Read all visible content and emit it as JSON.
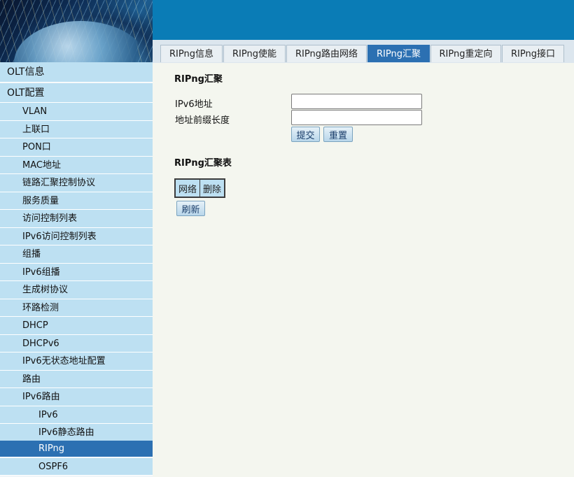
{
  "sidebar": {
    "items": [
      {
        "label": "OLT信息",
        "level": 0,
        "active": false
      },
      {
        "label": "OLT配置",
        "level": 0,
        "active": false
      },
      {
        "label": "VLAN",
        "level": 1,
        "active": false
      },
      {
        "label": "上联口",
        "level": 1,
        "active": false
      },
      {
        "label": "PON口",
        "level": 1,
        "active": false
      },
      {
        "label": "MAC地址",
        "level": 1,
        "active": false
      },
      {
        "label": "链路汇聚控制协议",
        "level": 1,
        "active": false
      },
      {
        "label": "服务质量",
        "level": 1,
        "active": false
      },
      {
        "label": "访问控制列表",
        "level": 1,
        "active": false
      },
      {
        "label": "IPv6访问控制列表",
        "level": 1,
        "active": false
      },
      {
        "label": "组播",
        "level": 1,
        "active": false
      },
      {
        "label": "IPv6组播",
        "level": 1,
        "active": false
      },
      {
        "label": "生成树协议",
        "level": 1,
        "active": false
      },
      {
        "label": "环路检测",
        "level": 1,
        "active": false
      },
      {
        "label": "DHCP",
        "level": 1,
        "active": false
      },
      {
        "label": "DHCPv6",
        "level": 1,
        "active": false
      },
      {
        "label": "IPv6无状态地址配置",
        "level": 1,
        "active": false
      },
      {
        "label": "路由",
        "level": 1,
        "active": false
      },
      {
        "label": "IPv6路由",
        "level": 1,
        "active": false
      },
      {
        "label": "IPv6",
        "level": 2,
        "active": false
      },
      {
        "label": "IPv6静态路由",
        "level": 2,
        "active": false
      },
      {
        "label": "RIPng",
        "level": 2,
        "active": true
      },
      {
        "label": "OSPF6",
        "level": 2,
        "active": false
      }
    ]
  },
  "tabs": [
    {
      "label": "RIPng信息",
      "active": false
    },
    {
      "label": "RIPng使能",
      "active": false
    },
    {
      "label": "RIPng路由网络",
      "active": false
    },
    {
      "label": "RIPng汇聚",
      "active": true
    },
    {
      "label": "RIPng重定向",
      "active": false
    },
    {
      "label": "RIPng接口",
      "active": false
    }
  ],
  "form": {
    "title": "RIPng汇聚",
    "ipv6_label": "IPv6地址",
    "ipv6_value": "",
    "prefix_label": "地址前缀长度",
    "prefix_value": "",
    "submit_label": "提交",
    "reset_label": "重置"
  },
  "table": {
    "title": "RIPng汇聚表",
    "columns": [
      "网络",
      "删除"
    ],
    "refresh_label": "刷新"
  },
  "colors": {
    "banner": "#0a7cb6",
    "sidebar_item": "#bde0f2",
    "active": "#2c70b2",
    "content_bg": "#f4f6ef"
  }
}
